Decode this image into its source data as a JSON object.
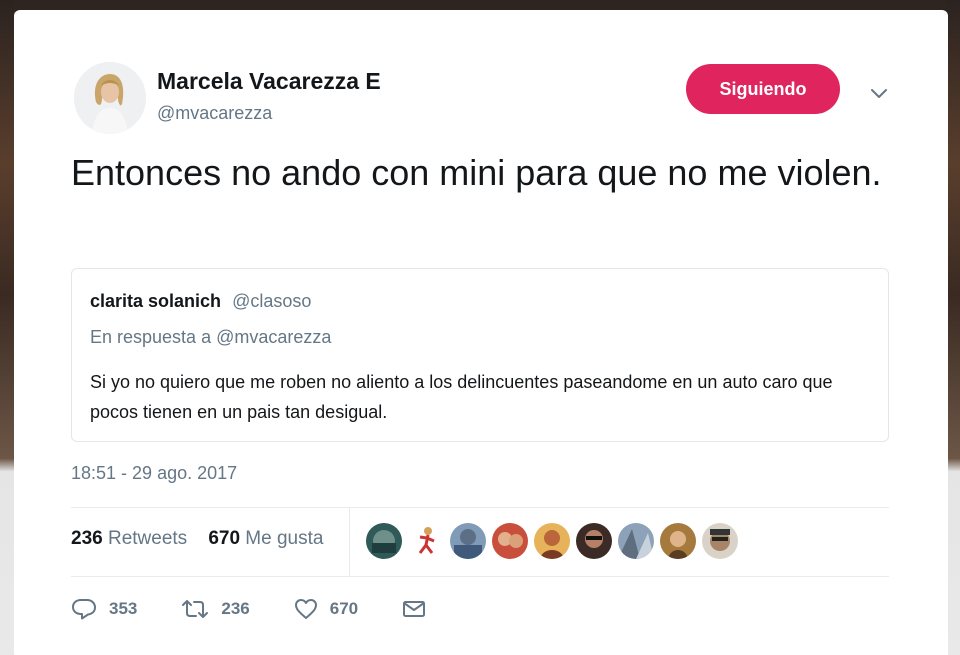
{
  "author": {
    "name": "Marcela Vacarezza E",
    "handle": "@mvacarezza",
    "follow_label": "Siguiendo"
  },
  "tweet": {
    "text": "Entonces no ando con mini para que no me violen.",
    "timestamp": "18:51 - 29 ago. 2017"
  },
  "quoted": {
    "name": "clarita solanich",
    "handle": "@clasoso",
    "reply_to": "En respuesta a @mvacarezza",
    "text": "Si yo no quiero que me roben no aliento a los delincuentes paseandome en un auto caro que pocos tienen en un pais tan desigual."
  },
  "stats": {
    "retweets_count": "236",
    "retweets_label": "Retweets",
    "likes_count": "670",
    "likes_label": "Me gusta"
  },
  "actions": {
    "replies": "353",
    "retweets": "236",
    "likes": "670"
  },
  "icons": {
    "reply": "reply-icon",
    "retweet": "retweet-icon",
    "like": "heart-icon",
    "dm": "envelope-icon",
    "caret": "chevron-down-icon"
  },
  "colors": {
    "accent": "#e0245e",
    "secondary_text": "#657786",
    "primary_text": "#14171a"
  }
}
